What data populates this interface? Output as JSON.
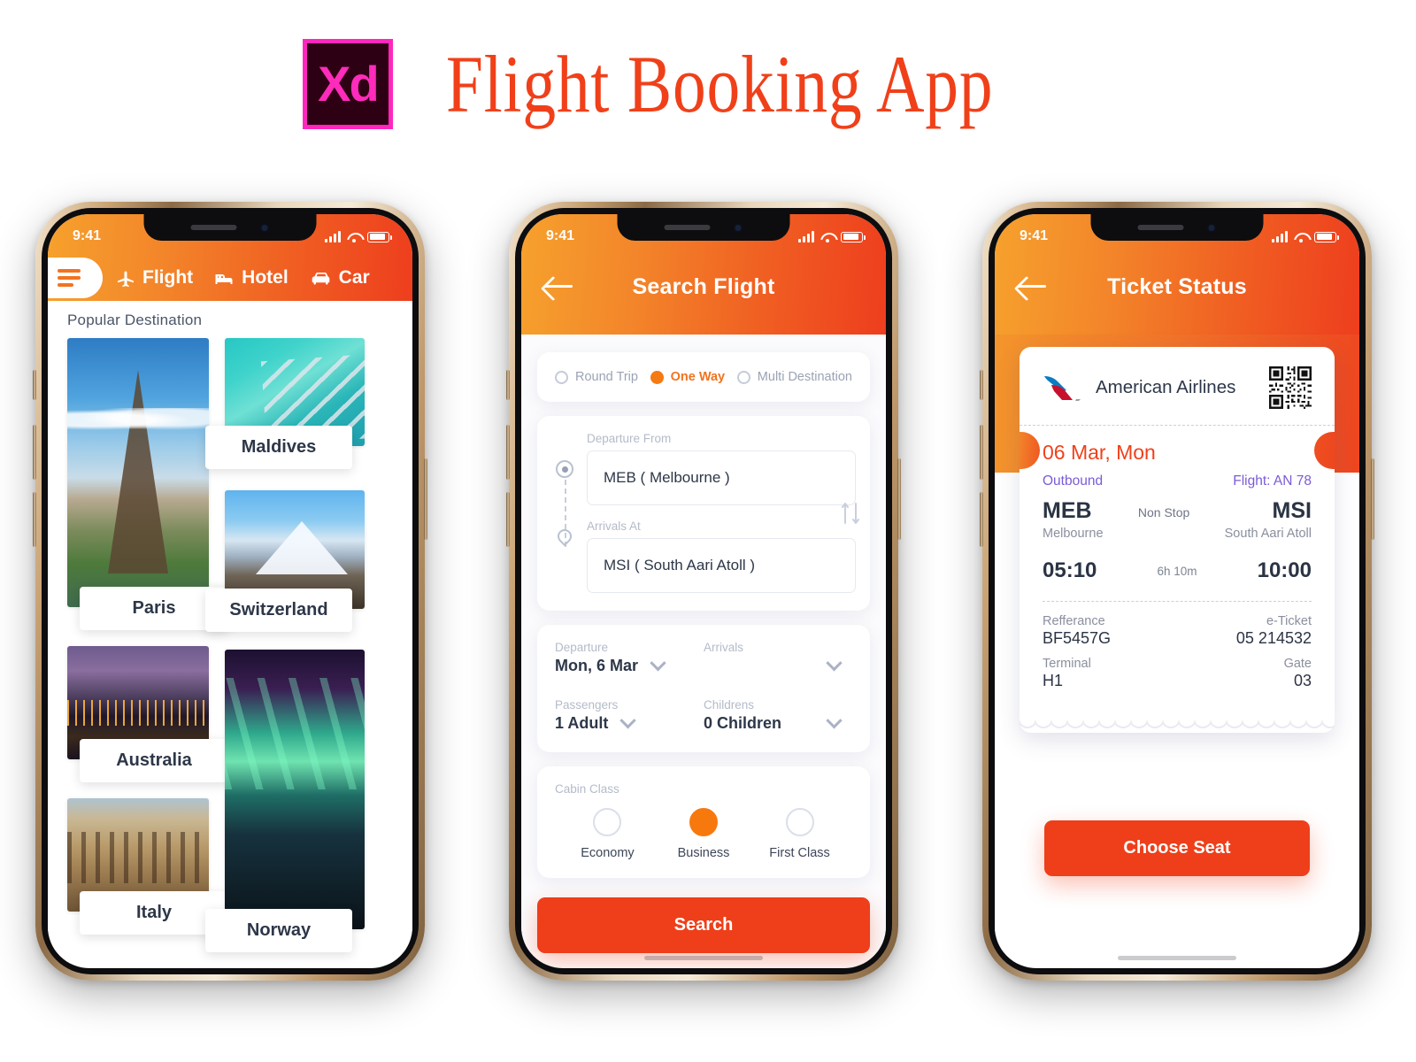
{
  "page": {
    "logo_text": "Xd",
    "title": "Flight Booking App"
  },
  "status_bar": {
    "time": "9:41"
  },
  "screen_home": {
    "nav": [
      {
        "label": "Flight",
        "icon": "airplane-icon"
      },
      {
        "label": "Hotel",
        "icon": "bed-icon"
      },
      {
        "label": "Car",
        "icon": "car-icon"
      }
    ],
    "section_title": "Popular Destination",
    "destinations": [
      {
        "name": "Paris"
      },
      {
        "name": "Maldives"
      },
      {
        "name": "Switzerland"
      },
      {
        "name": "Australia"
      },
      {
        "name": "Norway"
      },
      {
        "name": "Italy"
      }
    ]
  },
  "screen_search": {
    "title": "Search Flight",
    "back_icon": "back-arrow-icon",
    "trip_types": [
      {
        "label": "Round Trip",
        "selected": false
      },
      {
        "label": "One Way",
        "selected": true
      },
      {
        "label": "Multi Destination",
        "selected": false
      }
    ],
    "departure_from": {
      "label": "Departure From",
      "value": "MEB ( Melbourne )"
    },
    "arrivals_at": {
      "label": "Arrivals At",
      "value": "MSI ( South Aari Atoll )"
    },
    "swap_icon": "swap-vertical-icon",
    "departure_date": {
      "label": "Departure",
      "value": "Mon, 6 Mar"
    },
    "arrival_date": {
      "label": "Arrivals",
      "value": ""
    },
    "passengers": {
      "label": "Passengers",
      "value": "1 Adult"
    },
    "childrens": {
      "label": "Childrens",
      "value": "0 Children"
    },
    "cabin_class": {
      "label": "Cabin Class",
      "options": [
        {
          "label": "Economy",
          "selected": false
        },
        {
          "label": "Business",
          "selected": true
        },
        {
          "label": "First Class",
          "selected": false
        }
      ]
    },
    "search_button": "Search"
  },
  "screen_ticket": {
    "title": "Ticket Status",
    "back_icon": "back-arrow-icon",
    "airline": "American Airlines",
    "qr_icon": "qr-code-icon",
    "date": "06 Mar, Mon",
    "direction": "Outbound",
    "flight_no": "Flight: AN 78",
    "origin_code": "MEB",
    "origin_city": "Melbourne",
    "stop_info": "Non Stop",
    "destination_code": "MSI",
    "destination_city": "South Aari Atoll",
    "depart_time": "05:10",
    "duration": "6h 10m",
    "arrive_time": "10:00",
    "details": [
      {
        "key": "Refferance",
        "value": "BF5457G",
        "key2": "e-Ticket",
        "value2": "05 214532"
      },
      {
        "key": "Terminal",
        "value": "H1",
        "key2": "Gate",
        "value2": "03"
      }
    ],
    "choose_seat_button": "Choose Seat"
  },
  "colors": {
    "accent_orange": "#F2731F",
    "accent_red": "#EE3F1A",
    "purple": "#7B5BD6",
    "title_red": "#F0401A"
  }
}
